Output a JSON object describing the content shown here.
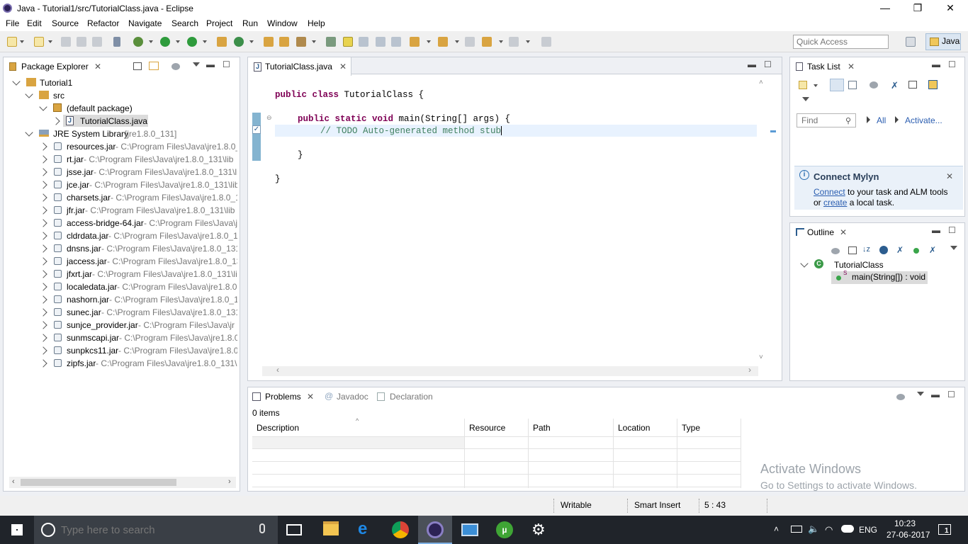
{
  "window": {
    "title": "Java - Tutorial1/src/TutorialClass.java - Eclipse",
    "minimize": "—",
    "restore": "❐",
    "close": "✕"
  },
  "menu": [
    "File",
    "Edit",
    "Source",
    "Refactor",
    "Navigate",
    "Search",
    "Project",
    "Run",
    "Window",
    "Help"
  ],
  "toolbar": {
    "quick_access_placeholder": "Quick Access",
    "perspective": "Java"
  },
  "package_explorer": {
    "title": "Package Explorer",
    "project": "Tutorial1",
    "src": "src",
    "package": "(default package)",
    "file": "TutorialClass.java",
    "jre_label": "JRE System Library",
    "jre_version": "[jre1.8.0_131]",
    "jars": [
      {
        "name": "resources.jar",
        "path": " - C:\\Program Files\\Java\\jre1.8.0_"
      },
      {
        "name": "rt.jar",
        "path": " - C:\\Program Files\\Java\\jre1.8.0_131\\lib"
      },
      {
        "name": "jsse.jar",
        "path": " - C:\\Program Files\\Java\\jre1.8.0_131\\li"
      },
      {
        "name": "jce.jar",
        "path": " - C:\\Program Files\\Java\\jre1.8.0_131\\lib"
      },
      {
        "name": "charsets.jar",
        "path": " - C:\\Program Files\\Java\\jre1.8.0_1"
      },
      {
        "name": "jfr.jar",
        "path": " - C:\\Program Files\\Java\\jre1.8.0_131\\lib"
      },
      {
        "name": "access-bridge-64.jar",
        "path": " - C:\\Program Files\\Java\\j"
      },
      {
        "name": "cldrdata.jar",
        "path": " - C:\\Program Files\\Java\\jre1.8.0_1"
      },
      {
        "name": "dnsns.jar",
        "path": " - C:\\Program Files\\Java\\jre1.8.0_131"
      },
      {
        "name": "jaccess.jar",
        "path": " - C:\\Program Files\\Java\\jre1.8.0_13"
      },
      {
        "name": "jfxrt.jar",
        "path": " - C:\\Program Files\\Java\\jre1.8.0_131\\li"
      },
      {
        "name": "localedata.jar",
        "path": " - C:\\Program Files\\Java\\jre1.8.0"
      },
      {
        "name": "nashorn.jar",
        "path": " - C:\\Program Files\\Java\\jre1.8.0_1"
      },
      {
        "name": "sunec.jar",
        "path": " - C:\\Program Files\\Java\\jre1.8.0_131"
      },
      {
        "name": "sunjce_provider.jar",
        "path": " - C:\\Program Files\\Java\\jr"
      },
      {
        "name": "sunmscapi.jar",
        "path": " - C:\\Program Files\\Java\\jre1.8.0"
      },
      {
        "name": "sunpkcs11.jar",
        "path": " - C:\\Program Files\\Java\\jre1.8.0"
      },
      {
        "name": "zipfs.jar",
        "path": " - C:\\Program Files\\Java\\jre1.8.0_131\\l"
      }
    ]
  },
  "editor": {
    "tab": "TutorialClass.java",
    "lines": {
      "l1_kw": "public class",
      "l1_rest": " TutorialClass {",
      "l2_kw": "public static void",
      "l2_rest": " main(String[] args) {",
      "l3": "// TODO Auto-generated method stub",
      "l4": "}",
      "l5": "}"
    }
  },
  "task_list": {
    "title": "Task List",
    "find_placeholder": "Find",
    "all": "All",
    "activate": "Activate..."
  },
  "mylyn": {
    "title": "Connect Mylyn",
    "connect": "Connect",
    "text1": " to your task and ALM tools",
    "or": "or ",
    "create": "create",
    "text2": " a local task."
  },
  "outline": {
    "title": "Outline",
    "class": "TutorialClass",
    "method": "main(String[]) : void",
    "static_marker": "S"
  },
  "problems": {
    "tabs": [
      "Problems",
      "Javadoc",
      "Declaration"
    ],
    "count": "0 items",
    "columns": [
      "Description",
      "Resource",
      "Path",
      "Location",
      "Type"
    ]
  },
  "watermark": {
    "line1": "Activate Windows",
    "line2": "Go to Settings to activate Windows."
  },
  "status": {
    "writable": "Writable",
    "insert": "Smart Insert",
    "position": "5 : 43"
  },
  "taskbar": {
    "search_placeholder": "Type here to search",
    "language": "ENG",
    "time": "10:23",
    "date": "27-06-2017",
    "notifications": "1"
  }
}
